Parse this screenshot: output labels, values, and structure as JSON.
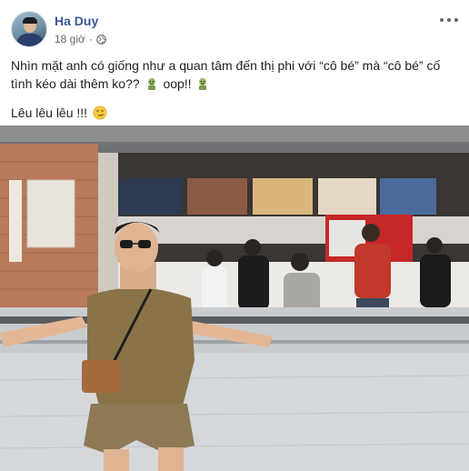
{
  "post": {
    "author": "Ha Duy",
    "time": "18 giờ",
    "separator": "·",
    "privacy_icon": "globe-icon",
    "more_icon": "more-options-icon",
    "text_line1_a": "Nhìn mặt anh có giống như a quan tâm đến thị phi với “cô bé” mà “cô bé” cố tình kéo dài thêm ko??",
    "text_line1_b": "oop!!",
    "text_line2": "Lêu lêu lêu !!!",
    "emojis": [
      "zombie-emoji",
      "zombie-emoji",
      "smirk-emoji"
    ],
    "photo_icon": "post-photo"
  },
  "colors": {
    "author_link": "#385898",
    "meta_text": "#616770",
    "body_text": "#1c1e21"
  }
}
